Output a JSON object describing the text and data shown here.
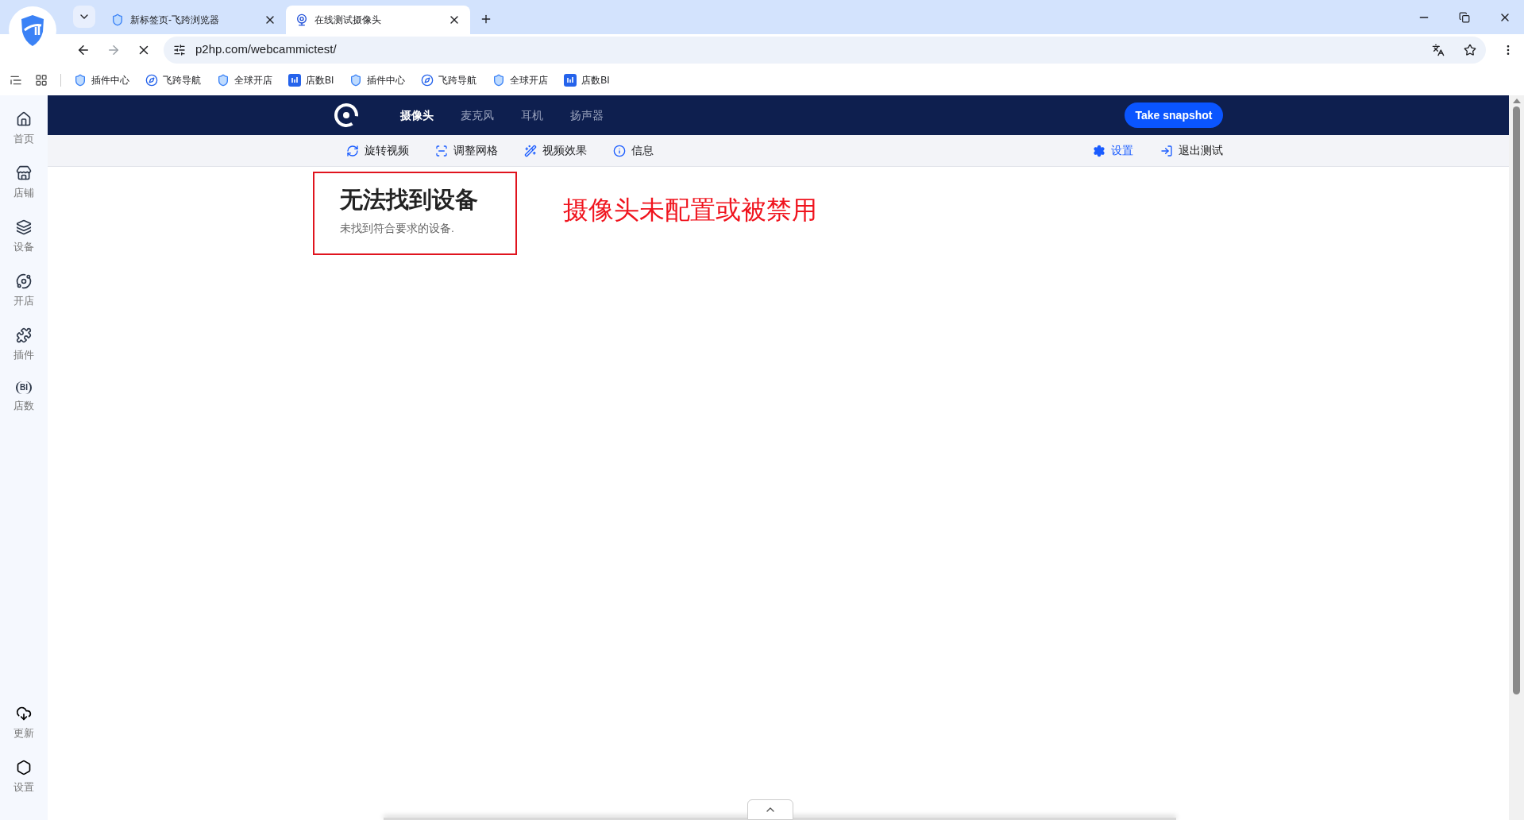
{
  "browser_tabs": [
    {
      "title": "新标签页-飞跨浏览器",
      "kind": "shield",
      "selected": false
    },
    {
      "title": "在线测试摄像头",
      "kind": "webcam",
      "selected": true
    }
  ],
  "address_bar": {
    "url": "p2hp.com/webcammictest/"
  },
  "bookmarks": [
    {
      "label": "插件中心",
      "kind": "shield"
    },
    {
      "label": "飞跨导航",
      "kind": "nav"
    },
    {
      "label": "全球开店",
      "kind": "shield"
    },
    {
      "label": "店数BI",
      "kind": "bi"
    },
    {
      "label": "插件中心",
      "kind": "shield"
    },
    {
      "label": "飞跨导航",
      "kind": "nav"
    },
    {
      "label": "全球开店",
      "kind": "shield"
    },
    {
      "label": "店数BI",
      "kind": "bi"
    }
  ],
  "sidebar": {
    "items": [
      {
        "label": "首页",
        "kind": "home"
      },
      {
        "label": "店铺",
        "kind": "store"
      },
      {
        "label": "设备",
        "kind": "layers"
      },
      {
        "label": "开店",
        "kind": "planet"
      },
      {
        "label": "插件",
        "kind": "puzzle"
      },
      {
        "label": "店数",
        "kind": "bi",
        "icon_text": "BI"
      }
    ],
    "bottom_items": [
      {
        "label": "更新",
        "kind": "cloud"
      },
      {
        "label": "设置",
        "kind": "nut"
      }
    ]
  },
  "nav": {
    "tabs": [
      {
        "label": "摄像头",
        "selected": true
      },
      {
        "label": "麦克风",
        "selected": false
      },
      {
        "label": "耳机",
        "selected": false
      },
      {
        "label": "扬声器",
        "selected": false
      }
    ],
    "snapshot_button": "Take snapshot"
  },
  "toolbar": {
    "left": [
      {
        "label": "旋转视频",
        "kind": "rotate"
      },
      {
        "label": "调整网格",
        "kind": "grid"
      },
      {
        "label": "视频效果",
        "kind": "wand"
      },
      {
        "label": "信息",
        "kind": "info"
      }
    ],
    "right": [
      {
        "label": "设置",
        "kind": "gear",
        "highlighted": true
      },
      {
        "label": "退出测试",
        "kind": "exit",
        "highlighted": false
      }
    ]
  },
  "error": {
    "title": "无法找到设备",
    "message": "未找到符合要求的设备."
  },
  "annotation": "摄像头未配置或被禁用"
}
